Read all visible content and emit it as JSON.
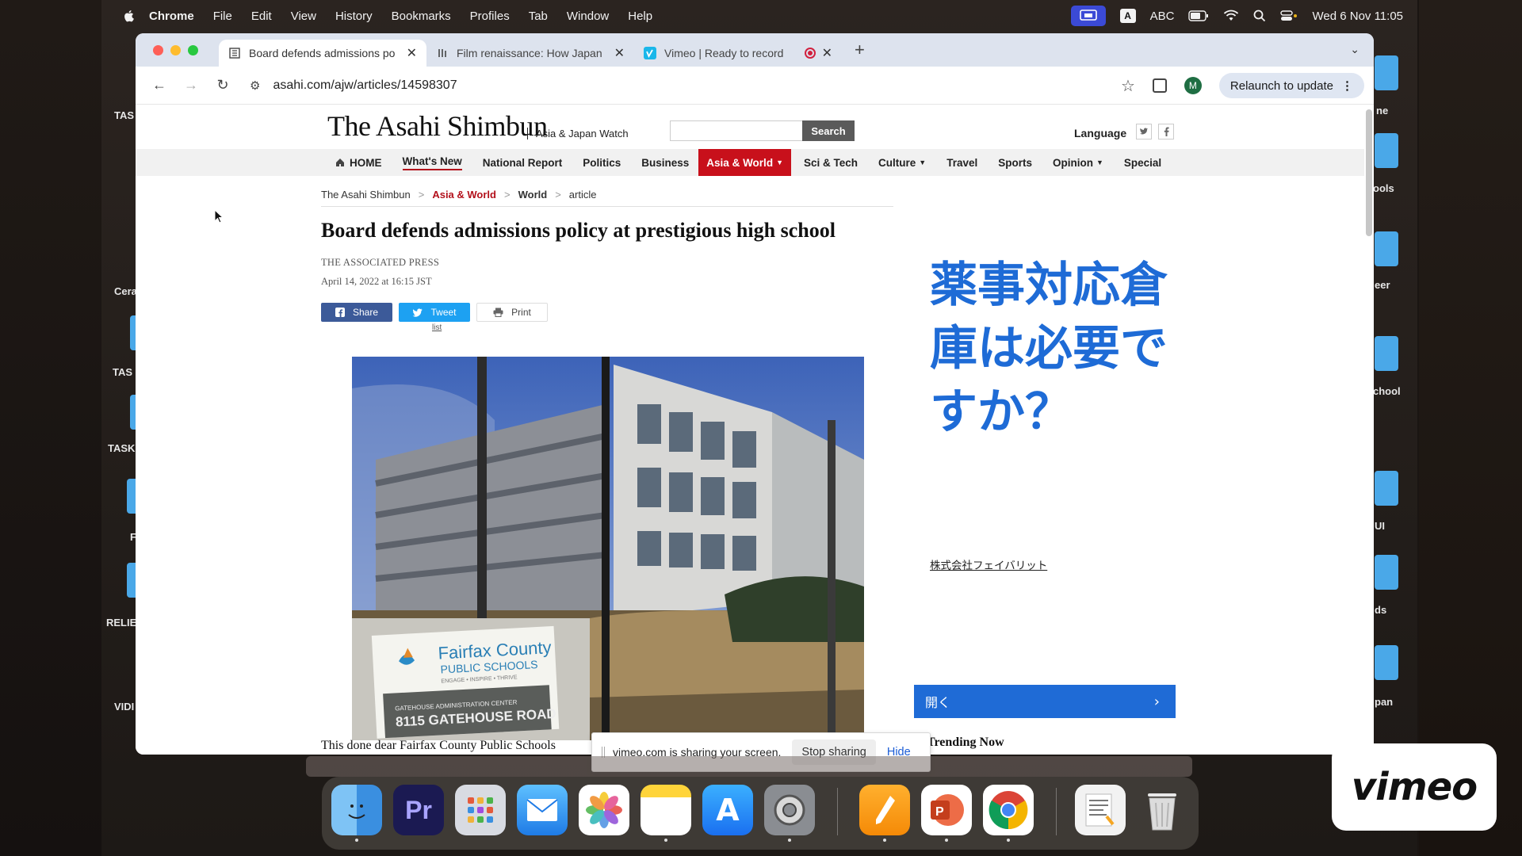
{
  "menubar": {
    "app": "Chrome",
    "items": [
      "File",
      "Edit",
      "View",
      "History",
      "Bookmarks",
      "Profiles",
      "Tab",
      "Window",
      "Help"
    ],
    "input_source": "ABC",
    "datetime": "Wed 6 Nov  11:05"
  },
  "desktop": {
    "left_labels": [
      "TAS",
      "Cera",
      "TAS",
      "TASK",
      "F",
      "RELIE",
      "VIDI"
    ],
    "right_labels": [
      "ne",
      "ools",
      "eer",
      "chool",
      "UI",
      "ds",
      "pan"
    ]
  },
  "tabs": [
    {
      "title": "Board defends admissions po",
      "favicon": "asahi-icon",
      "active": true
    },
    {
      "title": "Film renaissance: How Japan",
      "favicon": "asahi-icon",
      "active": false
    },
    {
      "title": "Vimeo | Ready to record",
      "favicon": "vimeo-icon",
      "active": false,
      "recording": true
    }
  ],
  "toolbar": {
    "url": "asahi.com/ajw/articles/14598307",
    "profile_initial": "M",
    "relaunch_label": "Relaunch to update"
  },
  "site": {
    "logo": "The Asahi Shimbun",
    "logo_sub": "Asia & Japan Watch",
    "search_placeholder": "",
    "search_label": "Search",
    "language_label": "Language",
    "nav": [
      {
        "label": "HOME",
        "icon": "home-icon"
      },
      {
        "label": "What's New",
        "current": true
      },
      {
        "label": "National Report"
      },
      {
        "label": "Politics"
      },
      {
        "label": "Business"
      },
      {
        "label": "Asia & World",
        "active": true,
        "dropdown": true
      },
      {
        "label": "Sci & Tech"
      },
      {
        "label": "Culture",
        "dropdown": true
      },
      {
        "label": "Travel"
      },
      {
        "label": "Sports"
      },
      {
        "label": "Opinion",
        "dropdown": true
      },
      {
        "label": "Special"
      }
    ],
    "accent_color": "#c8101b"
  },
  "breadcrumb": [
    "The Asahi Shimbun",
    "Asia & World",
    "World",
    "article"
  ],
  "article": {
    "title": "Board defends admissions policy at prestigious high school",
    "byline": "THE ASSOCIATED PRESS",
    "date": "April 14, 2022 at 16:15 JST",
    "share_label": "Share",
    "tweet_label": "Tweet",
    "print_label": "Print",
    "list_label": "list",
    "image_sign": {
      "name": "Fairfax County",
      "sub": "PUBLIC SCHOOLS",
      "motto": "ENGAGE • INSPIRE • THRIVE",
      "center": "GATEHOUSE ADMINISTRATION CENTER",
      "address": "8115 GATEHOUSE ROAD"
    },
    "body_peek": "This done dear Fairfax County Public Schools"
  },
  "ad": {
    "headline": "薬事対応倉庫は必要ですか？",
    "company": "株式会社フェイバリット",
    "cta": "開く"
  },
  "sidebar": {
    "trending": "Trending Now"
  },
  "sharing_banner": {
    "text": "vimeo.com is sharing your screen.",
    "stop": "Stop sharing",
    "hide": "Hide"
  },
  "dock": {
    "apps": [
      "finder-icon",
      "premiere-icon",
      "launchpad-icon",
      "mail-icon",
      "photos-icon",
      "notes-icon",
      "app-store-icon",
      "system-settings-icon",
      "pages-icon",
      "powerpoint-icon",
      "chrome-icon",
      "preview-icon",
      "trash-icon"
    ]
  },
  "vimeo_badge": "vimeo"
}
